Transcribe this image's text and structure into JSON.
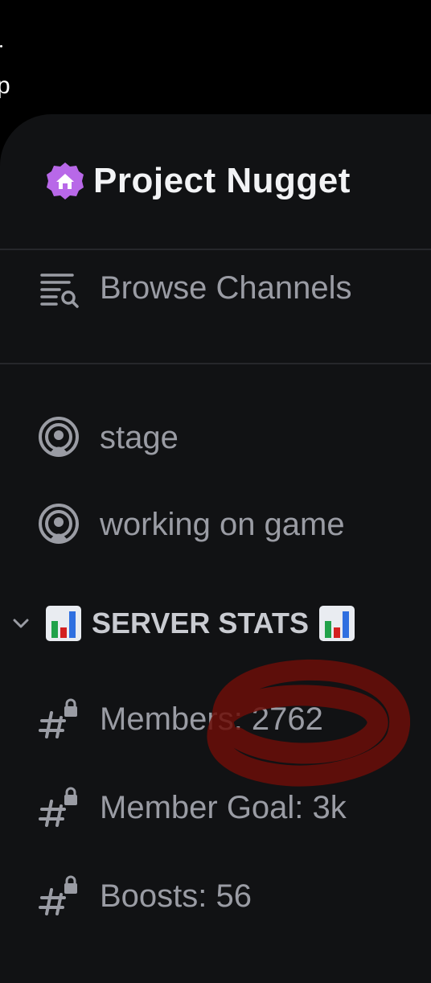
{
  "statusbar": {
    "cutoff_text": "p"
  },
  "server": {
    "name": "Project Nugget",
    "badge_icon": "home-icon",
    "badge_color": "#b868e8"
  },
  "browse": {
    "label": "Browse Channels",
    "icon": "browse-channels-icon"
  },
  "voice_channels": [
    {
      "name": "stage",
      "icon": "stage-icon"
    },
    {
      "name": "working on game",
      "icon": "stage-icon"
    }
  ],
  "category": {
    "label": "SERVER STATS",
    "expanded": true,
    "emoji": "bar-chart-icon"
  },
  "locked_channels": [
    {
      "name": "Members: 2762",
      "icon": "locked-text-channel-icon"
    },
    {
      "name": "Member Goal: 3k",
      "icon": "locked-text-channel-icon"
    },
    {
      "name": "Boosts: 56",
      "icon": "locked-text-channel-icon"
    }
  ],
  "colors": {
    "panel_bg": "#111214",
    "text_muted": "#9a9ca4",
    "text_bright": "#f2f3f5",
    "annotation_red": "#7a0f08"
  }
}
